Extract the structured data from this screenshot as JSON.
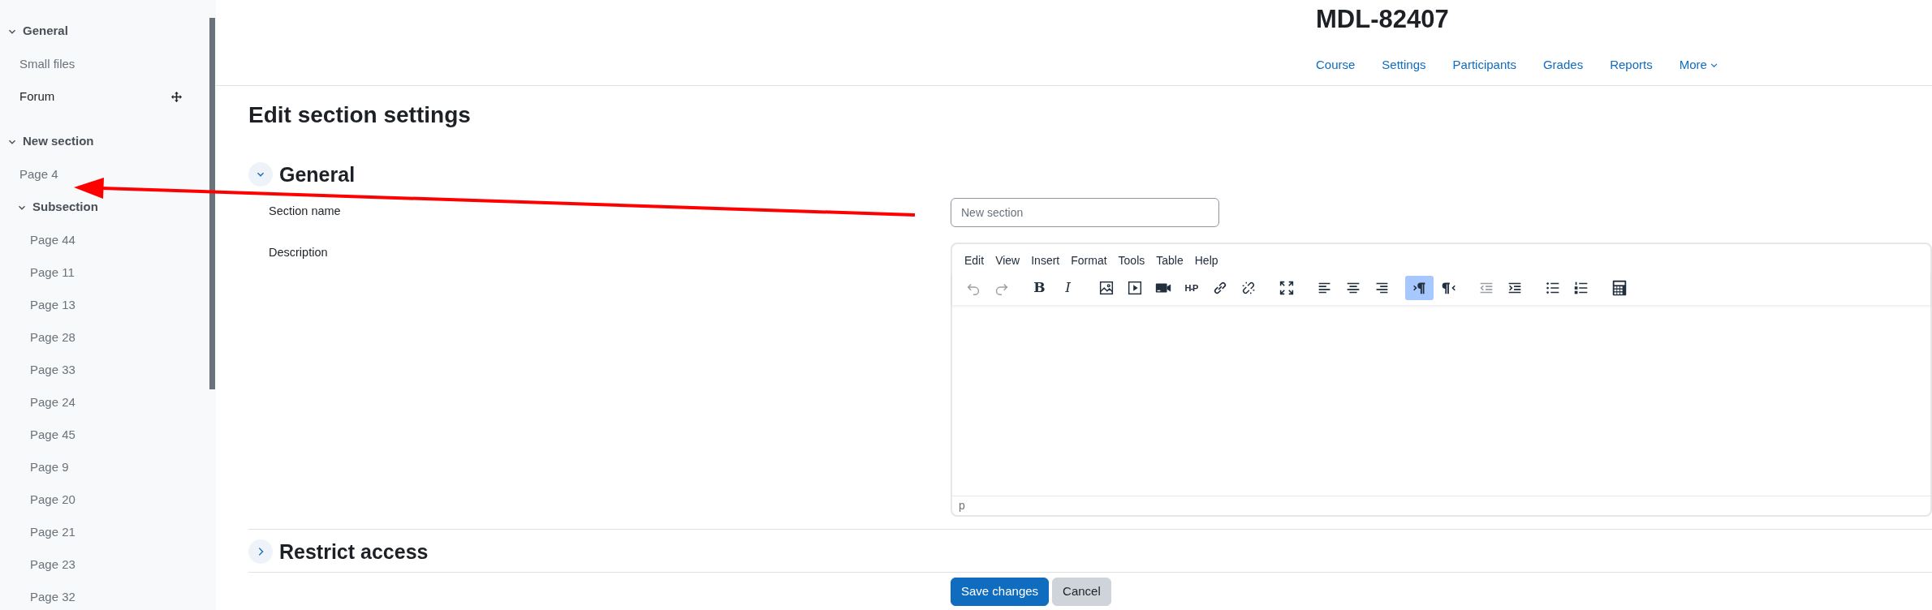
{
  "sidebar": {
    "nodes": [
      {
        "kind": "section",
        "title": "General",
        "expanded": true,
        "children": [
          {
            "kind": "item",
            "label": "Small files",
            "active": false
          },
          {
            "kind": "item",
            "label": "Forum",
            "active": true
          }
        ]
      },
      {
        "kind": "section",
        "title": "New section",
        "expanded": true,
        "children": [
          {
            "kind": "item",
            "label": "Page 4",
            "active": false
          },
          {
            "kind": "section",
            "title": "Subsection",
            "expanded": true,
            "children": [
              {
                "kind": "item",
                "label": "Page 44",
                "active": false
              },
              {
                "kind": "item",
                "label": "Page 11",
                "active": false
              },
              {
                "kind": "item",
                "label": "Page 13",
                "active": false
              },
              {
                "kind": "item",
                "label": "Page 28",
                "active": false
              },
              {
                "kind": "item",
                "label": "Page 33",
                "active": false
              },
              {
                "kind": "item",
                "label": "Page 24",
                "active": false
              },
              {
                "kind": "item",
                "label": "Page 45",
                "active": false
              },
              {
                "kind": "item",
                "label": "Page 9",
                "active": false
              },
              {
                "kind": "item",
                "label": "Page 20",
                "active": false
              },
              {
                "kind": "item",
                "label": "Page 21",
                "active": false
              },
              {
                "kind": "item",
                "label": "Page 23",
                "active": false
              },
              {
                "kind": "item",
                "label": "Page 32",
                "active": false
              }
            ]
          }
        ]
      }
    ]
  },
  "header": {
    "title": "MDL-82407",
    "nav": [
      {
        "label": "Course",
        "dropdown": false
      },
      {
        "label": "Settings",
        "dropdown": false
      },
      {
        "label": "Participants",
        "dropdown": false
      },
      {
        "label": "Grades",
        "dropdown": false
      },
      {
        "label": "Reports",
        "dropdown": false
      },
      {
        "label": "More",
        "dropdown": true
      }
    ]
  },
  "page_title": "Edit section settings",
  "sections": [
    {
      "title": "General",
      "expanded": true,
      "fields": [
        {
          "kind": "text",
          "label": "Section name",
          "placeholder": "New section"
        },
        {
          "kind": "editor",
          "label": "Description",
          "menu": [
            "Edit",
            "View",
            "Insert",
            "Format",
            "Tools",
            "Table",
            "Help"
          ],
          "toolbar": [
            [
              {
                "kind": "undo",
                "disabled": true,
                "selected": false
              },
              {
                "kind": "redo",
                "disabled": true,
                "selected": false
              }
            ],
            [
              {
                "kind": "bold",
                "label": "B",
                "disabled": false,
                "selected": false
              },
              {
                "kind": "italic",
                "label": "I",
                "disabled": false,
                "selected": false
              }
            ],
            [
              {
                "kind": "image",
                "disabled": false,
                "selected": false
              },
              {
                "kind": "media",
                "disabled": false,
                "selected": false
              },
              {
                "kind": "video",
                "disabled": false,
                "selected": false
              },
              {
                "kind": "h5p",
                "label": "H-P",
                "disabled": false,
                "selected": false
              },
              {
                "kind": "link",
                "disabled": false,
                "selected": false
              },
              {
                "kind": "unlink",
                "disabled": false,
                "selected": false
              }
            ],
            [
              {
                "kind": "fullscreen",
                "disabled": false,
                "selected": false
              }
            ],
            [
              {
                "kind": "align-left",
                "disabled": false,
                "selected": false
              },
              {
                "kind": "align-center",
                "disabled": false,
                "selected": false
              },
              {
                "kind": "align-right",
                "disabled": false,
                "selected": false
              }
            ],
            [
              {
                "kind": "ltr",
                "disabled": false,
                "selected": true
              },
              {
                "kind": "rtl",
                "disabled": false,
                "selected": false
              }
            ],
            [
              {
                "kind": "outdent",
                "disabled": true,
                "selected": false
              },
              {
                "kind": "indent",
                "disabled": false,
                "selected": false
              }
            ],
            [
              {
                "kind": "bullet-list",
                "disabled": false,
                "selected": false
              },
              {
                "kind": "numbered-list",
                "disabled": false,
                "selected": false
              }
            ],
            [
              {
                "kind": "calculator",
                "disabled": false,
                "selected": false
              }
            ]
          ],
          "status": "p"
        }
      ]
    },
    {
      "title": "Restrict access",
      "expanded": false
    }
  ],
  "buttons": [
    {
      "label": "Save changes",
      "kind": "primary"
    },
    {
      "label": "Cancel",
      "kind": "secondary"
    }
  ]
}
